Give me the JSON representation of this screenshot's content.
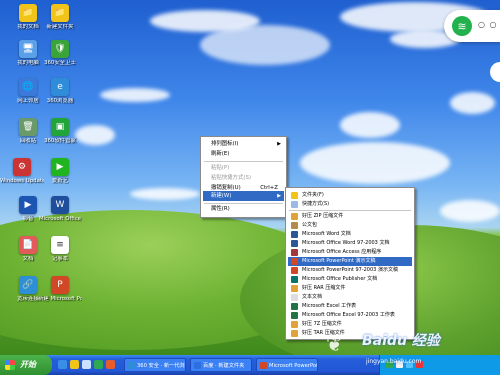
{
  "desktop_icons": [
    {
      "label": "我的文档",
      "color": "#f0c419",
      "glyph": "📁"
    },
    {
      "label": "我的电脑",
      "color": "#5aa0e8",
      "glyph": "🖥"
    },
    {
      "label": "网上邻居",
      "color": "#3b7ad9",
      "glyph": "🌐"
    },
    {
      "label": "回收站",
      "color": "#6a9a6a",
      "glyph": "🗑"
    },
    {
      "label": "Windows Update",
      "color": "#c33",
      "glyph": "⚙"
    },
    {
      "label": "影音",
      "color": "#1d55b3",
      "glyph": "▶"
    },
    {
      "label": "文档",
      "color": "#e25b5b",
      "glyph": "📄"
    },
    {
      "label": "宽带连接",
      "color": "#2d8fd6",
      "glyph": "🔗"
    },
    {
      "label": "新建文件夹",
      "color": "#f0c419",
      "glyph": "📁"
    },
    {
      "label": "360安全卫士",
      "color": "#3aa33a",
      "glyph": "🛡"
    },
    {
      "label": "360浏览器",
      "color": "#2f8cd8",
      "glyph": "e"
    },
    {
      "label": "360软件管家",
      "color": "#21a53b",
      "glyph": "▣"
    },
    {
      "label": "爱奇艺",
      "color": "#20b520",
      "glyph": "▶"
    },
    {
      "label": "Microsoft Office",
      "color": "#1f4e9c",
      "glyph": "W"
    },
    {
      "label": "记事本",
      "color": "#ffffff",
      "glyph": "≡"
    },
    {
      "label": "新建 Microsoft PowerPoint 演示文稿",
      "color": "#d24726",
      "glyph": "P"
    }
  ],
  "context_menu": {
    "items": [
      {
        "label": "排列图标(I)",
        "arrow": "▶",
        "state": "normal"
      },
      {
        "label": "刷新(E)",
        "state": "normal"
      },
      {
        "label": "粘贴(P)",
        "state": "disabled"
      },
      {
        "label": "粘贴快捷方式(S)",
        "state": "disabled"
      },
      {
        "label": "撤销复制(U)",
        "shortcut": "Ctrl+Z",
        "state": "normal"
      },
      {
        "label": "新建(W)",
        "arrow": "▶",
        "state": "highlighted"
      },
      {
        "label": "属性(R)",
        "state": "normal"
      }
    ]
  },
  "new_submenu": {
    "items": [
      {
        "label": "文件夹(F)",
        "icon_color": "#f0c419"
      },
      {
        "label": "快捷方式(S)",
        "icon_color": "#9bbbe6"
      },
      {
        "label": "好压 ZIP 压缩文件",
        "icon_color": "#e2a23a"
      },
      {
        "label": "公文包",
        "icon_color": "#b38b4d"
      },
      {
        "label": "Microsoft Word 文档",
        "icon_color": "#2b5797"
      },
      {
        "label": "Microsoft Office Word 97-2003 文档",
        "icon_color": "#2b5797"
      },
      {
        "label": "Microsoft Office Access 应用程序",
        "icon_color": "#a4373a"
      },
      {
        "label": "Microsoft PowerPoint 演示文稿",
        "icon_color": "#d24726",
        "highlighted": true
      },
      {
        "label": "Microsoft PowerPoint 97-2003 演示文稿",
        "icon_color": "#d24726"
      },
      {
        "label": "Microsoft Office Publisher 文档",
        "icon_color": "#077568"
      },
      {
        "label": "好压 RAR 压缩文件",
        "icon_color": "#e2a23a"
      },
      {
        "label": "文本文档",
        "icon_color": "#dddddd"
      },
      {
        "label": "Microsoft Excel 工作表",
        "icon_color": "#217346"
      },
      {
        "label": "Microsoft Office Excel 97-2003 工作表",
        "icon_color": "#217346"
      },
      {
        "label": "好压 7Z 压缩文件",
        "icon_color": "#e2a23a"
      },
      {
        "label": "好压 TAR 压缩文件",
        "icon_color": "#e2a23a"
      }
    ]
  },
  "taskbar": {
    "start_label": "开始",
    "buttons": [
      {
        "label": "360 安全 · 新一代浏览",
        "icon_color": "#2f8cd8"
      },
      {
        "label": "百度 · 新建文件夹",
        "icon_color": "#2d6ee0"
      },
      {
        "label": "Microsoft PowerPoint",
        "icon_color": "#d24726"
      }
    ]
  },
  "watermark": {
    "text": "Baidu 经验",
    "url": "jingyan.baidu.com"
  }
}
